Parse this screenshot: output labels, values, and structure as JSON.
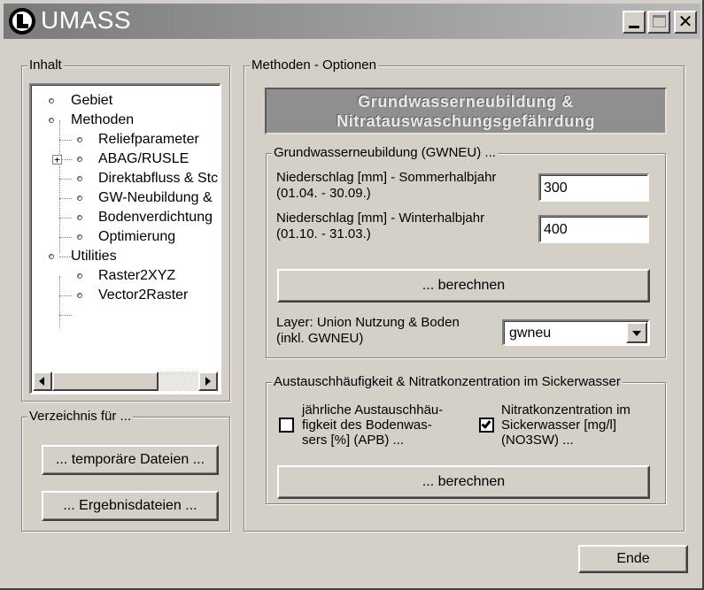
{
  "window": {
    "title": "UMASS"
  },
  "inhalt": {
    "label": "Inhalt",
    "tree": [
      {
        "label": "Gebiet"
      },
      {
        "label": "Methoden"
      },
      {
        "label": "Reliefparameter"
      },
      {
        "label": "ABAG/RUSLE"
      },
      {
        "label": "Direktabfluss & Stc"
      },
      {
        "label": "GW-Neubildung &"
      },
      {
        "label": "Bodenverdichtung"
      },
      {
        "label": "Optimierung"
      },
      {
        "label": "Utilities"
      },
      {
        "label": "Raster2XYZ"
      },
      {
        "label": "Vector2Raster"
      }
    ]
  },
  "verzeichnis": {
    "label": "Verzeichnis für ...",
    "temp_button": "... temporäre Dateien ...",
    "results_button": "... Ergebnisdateien ..."
  },
  "methoden": {
    "label": "Methoden - Optionen",
    "heading_line1": "Grundwasserneubildung &",
    "heading_line2": "Nitratauswaschungsgefährdung",
    "gwneu": {
      "label": "Grundwasserneubildung (GWNEU) ...",
      "summer_label_1": "Niederschlag [mm] - Sommerhalbjahr",
      "summer_label_2": "(01.04. - 30.09.)",
      "summer_value": "300",
      "winter_label_1": "Niederschlag [mm] - Winterhalbjahr",
      "winter_label_2": "(01.10. - 31.03.)",
      "winter_value": "400",
      "calc_button": "... berechnen",
      "layer_label_1": "Layer: Union Nutzung & Boden",
      "layer_label_2": "(inkl. GWNEU)",
      "layer_value": "gwneu"
    },
    "austausch": {
      "label": "Austauschhäufigkeit & Nitratkonzentration im Sickerwasser",
      "apb_line1": "jährliche Austauschhäu-",
      "apb_line2": "figkeit des Bodenwas-",
      "apb_line3": "sers [%] (APB) ...",
      "apb_checked": false,
      "no3_line1": "Nitratkonzentration im",
      "no3_line2": "Sickerwasser [mg/l]",
      "no3_line3": "(NO3SW) ...",
      "no3_checked": true,
      "calc_button": "... berechnen"
    }
  },
  "footer": {
    "end_button": "Ende"
  }
}
